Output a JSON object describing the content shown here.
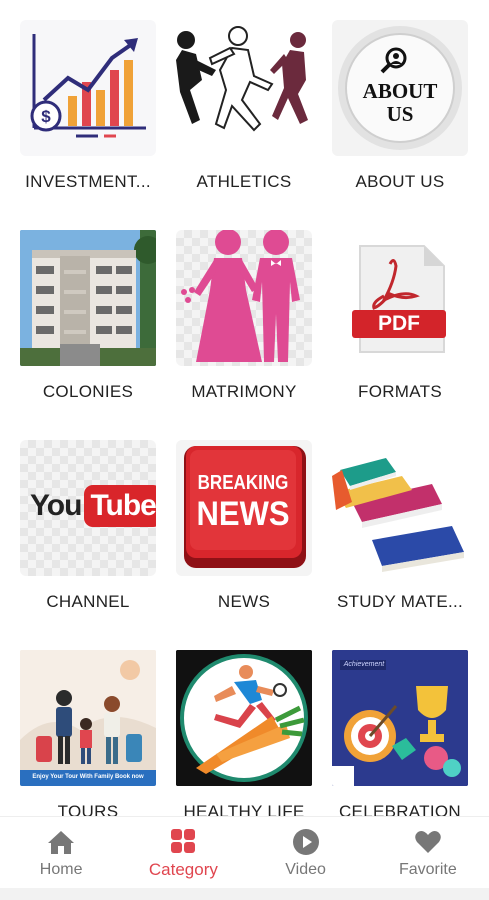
{
  "categories": [
    {
      "label": "INVESTMENT...",
      "icon": "investment-chart-icon"
    },
    {
      "label": "ATHLETICS",
      "icon": "runners-icon"
    },
    {
      "label": "ABOUT US",
      "icon": "about-us-button-icon",
      "image_text": "ABOUT US"
    },
    {
      "label": "COLONIES",
      "icon": "apartment-building-icon"
    },
    {
      "label": "MATRIMONY",
      "icon": "bride-groom-icon"
    },
    {
      "label": "FORMATS",
      "icon": "pdf-file-icon",
      "image_text": "PDF"
    },
    {
      "label": "CHANNEL",
      "icon": "youtube-logo-icon",
      "image_text_1": "You",
      "image_text_2": "Tube"
    },
    {
      "label": "NEWS",
      "icon": "breaking-news-icon",
      "image_text_1": "BREAKING",
      "image_text_2": "NEWS"
    },
    {
      "label": "STUDY MATE...",
      "icon": "books-stack-icon"
    },
    {
      "label": "TOURS",
      "icon": "family-travel-icon",
      "image_text": "Enjoy Your Tour With Family Book now"
    },
    {
      "label": "HEALTHY LIFE",
      "icon": "runner-carrot-icon"
    },
    {
      "label": "CELEBRATION",
      "icon": "trophy-achievement-icon",
      "image_text": "Achievement"
    }
  ],
  "nav": {
    "home": "Home",
    "category": "Category",
    "video": "Video",
    "favorite": "Favorite"
  },
  "colors": {
    "accent": "#e0464f",
    "inactive": "#777777"
  }
}
